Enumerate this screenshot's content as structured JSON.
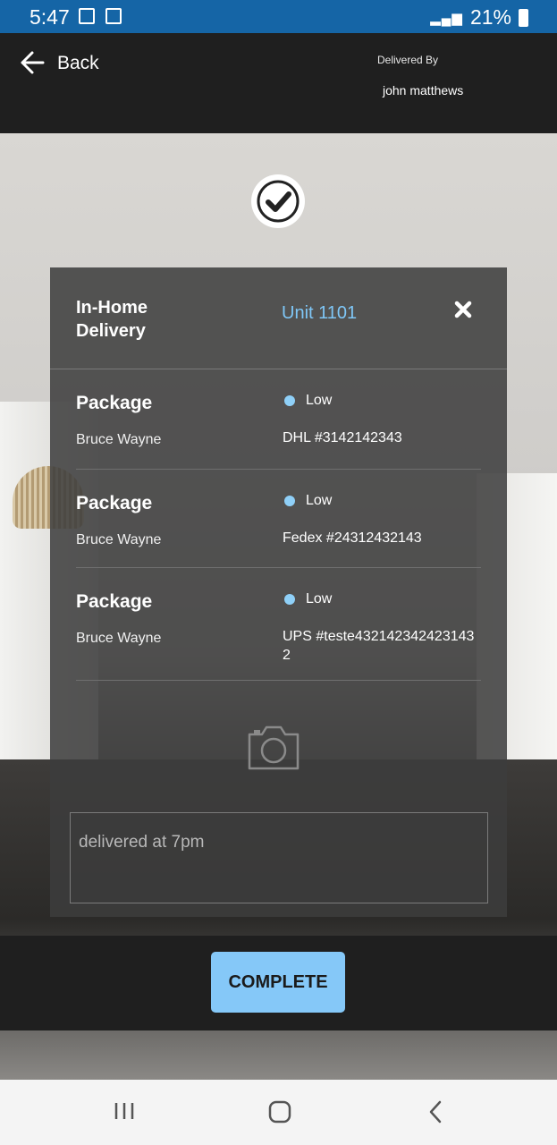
{
  "status_bar": {
    "time": "5:47",
    "battery": "21%"
  },
  "header": {
    "back_label": "Back",
    "delivered_by_label": "Delivered By",
    "delivered_by_name": "john matthews"
  },
  "card": {
    "delivery_type": "In-Home Delivery",
    "unit": "Unit 1101",
    "packages": [
      {
        "title": "Package",
        "recipient": "Bruce Wayne",
        "priority": "Low",
        "tracking": "DHL #3142142343"
      },
      {
        "title": "Package",
        "recipient": "Bruce Wayne",
        "priority": "Low",
        "tracking": "Fedex #24312432143"
      },
      {
        "title": "Package",
        "recipient": "Bruce Wayne",
        "priority": "Low",
        "tracking": "UPS #teste4321423424231432"
      }
    ],
    "note": "delivered at 7pm"
  },
  "actions": {
    "complete_label": "COMPLETE"
  },
  "colors": {
    "accent": "#85c8f8",
    "status_bar": "#1565a6",
    "header": "#1f1f1f"
  },
  "icons": [
    "back-arrow-icon",
    "check-circle-icon",
    "close-icon",
    "camera-icon",
    "priority-dot-icon"
  ]
}
